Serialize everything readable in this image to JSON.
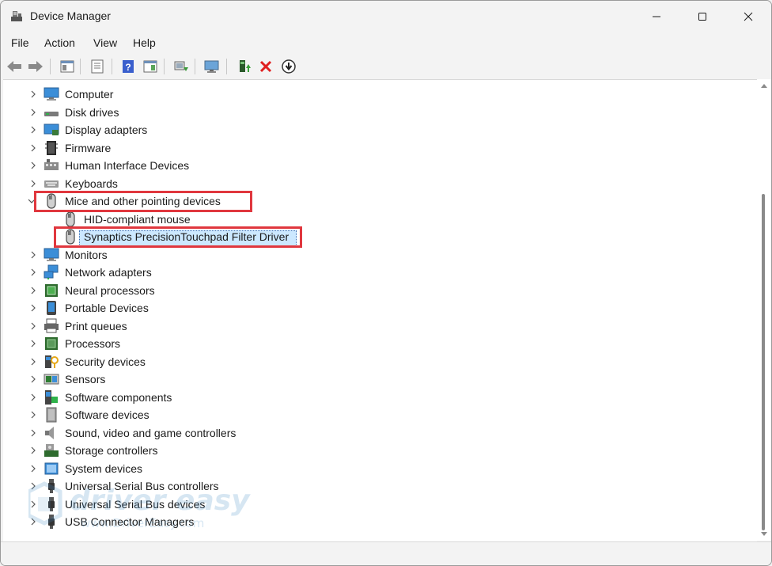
{
  "window": {
    "title": "Device Manager",
    "controls": [
      "minimize",
      "maximize",
      "close"
    ]
  },
  "menubar": {
    "items": [
      "File",
      "Action",
      "View",
      "Help"
    ]
  },
  "toolbar": {
    "buttons": [
      {
        "name": "back",
        "icon": "back-arrow-icon"
      },
      {
        "name": "forward",
        "icon": "forward-arrow-icon"
      },
      {
        "name": "show-hide-console-tree",
        "icon": "console-tree-icon"
      },
      {
        "name": "properties",
        "icon": "properties-icon"
      },
      {
        "name": "help",
        "icon": "help-icon"
      },
      {
        "name": "action-pane",
        "icon": "action-pane-icon"
      },
      {
        "name": "scan-hardware",
        "icon": "scan-hardware-icon"
      },
      {
        "name": "display-view",
        "icon": "monitor-view-icon"
      },
      {
        "name": "update-driver",
        "icon": "update-driver-icon"
      },
      {
        "name": "uninstall-device",
        "icon": "uninstall-x-icon"
      },
      {
        "name": "disable-device",
        "icon": "disable-device-icon"
      }
    ]
  },
  "tree": {
    "categories": [
      {
        "label": "Computer",
        "icon": "computer-icon",
        "expanded": false
      },
      {
        "label": "Disk drives",
        "icon": "disk-drive-icon",
        "expanded": false
      },
      {
        "label": "Display adapters",
        "icon": "display-adapter-icon",
        "expanded": false
      },
      {
        "label": "Firmware",
        "icon": "firmware-icon",
        "expanded": false
      },
      {
        "label": "Human Interface Devices",
        "icon": "hid-icon",
        "expanded": false
      },
      {
        "label": "Keyboards",
        "icon": "keyboard-icon",
        "expanded": false
      },
      {
        "label": "Mice and other pointing devices",
        "icon": "mouse-icon",
        "expanded": true,
        "children": [
          {
            "label": "HID-compliant mouse",
            "icon": "mouse-icon",
            "selected": false
          },
          {
            "label": "Synaptics PrecisionTouchpad Filter Driver",
            "icon": "mouse-icon",
            "selected": true
          }
        ]
      },
      {
        "label": "Monitors",
        "icon": "monitor-icon",
        "expanded": false
      },
      {
        "label": "Network adapters",
        "icon": "network-adapter-icon",
        "expanded": false
      },
      {
        "label": "Neural processors",
        "icon": "neural-processor-icon",
        "expanded": false
      },
      {
        "label": "Portable Devices",
        "icon": "portable-device-icon",
        "expanded": false
      },
      {
        "label": "Print queues",
        "icon": "printer-icon",
        "expanded": false
      },
      {
        "label": "Processors",
        "icon": "processor-icon",
        "expanded": false
      },
      {
        "label": "Security devices",
        "icon": "security-device-icon",
        "expanded": false
      },
      {
        "label": "Sensors",
        "icon": "sensor-icon",
        "expanded": false
      },
      {
        "label": "Software components",
        "icon": "software-component-icon",
        "expanded": false
      },
      {
        "label": "Software devices",
        "icon": "software-device-icon",
        "expanded": false
      },
      {
        "label": "Sound, video and game controllers",
        "icon": "speaker-icon",
        "expanded": false
      },
      {
        "label": "Storage controllers",
        "icon": "storage-controller-icon",
        "expanded": false
      },
      {
        "label": "System devices",
        "icon": "system-device-icon",
        "expanded": false
      },
      {
        "label": "Universal Serial Bus controllers",
        "icon": "usb-icon",
        "expanded": false
      },
      {
        "label": "Universal Serial Bus devices",
        "icon": "usb-icon",
        "expanded": false
      },
      {
        "label": "USB Connector Managers",
        "icon": "usb-icon",
        "expanded": false
      }
    ]
  },
  "watermark": {
    "brand": "driver easy",
    "url": "www.DriverEasy.com"
  },
  "colors": {
    "highlight_red": "#e0373e",
    "selection": "#cce8ff",
    "window_bg": "#f3f3f3"
  }
}
